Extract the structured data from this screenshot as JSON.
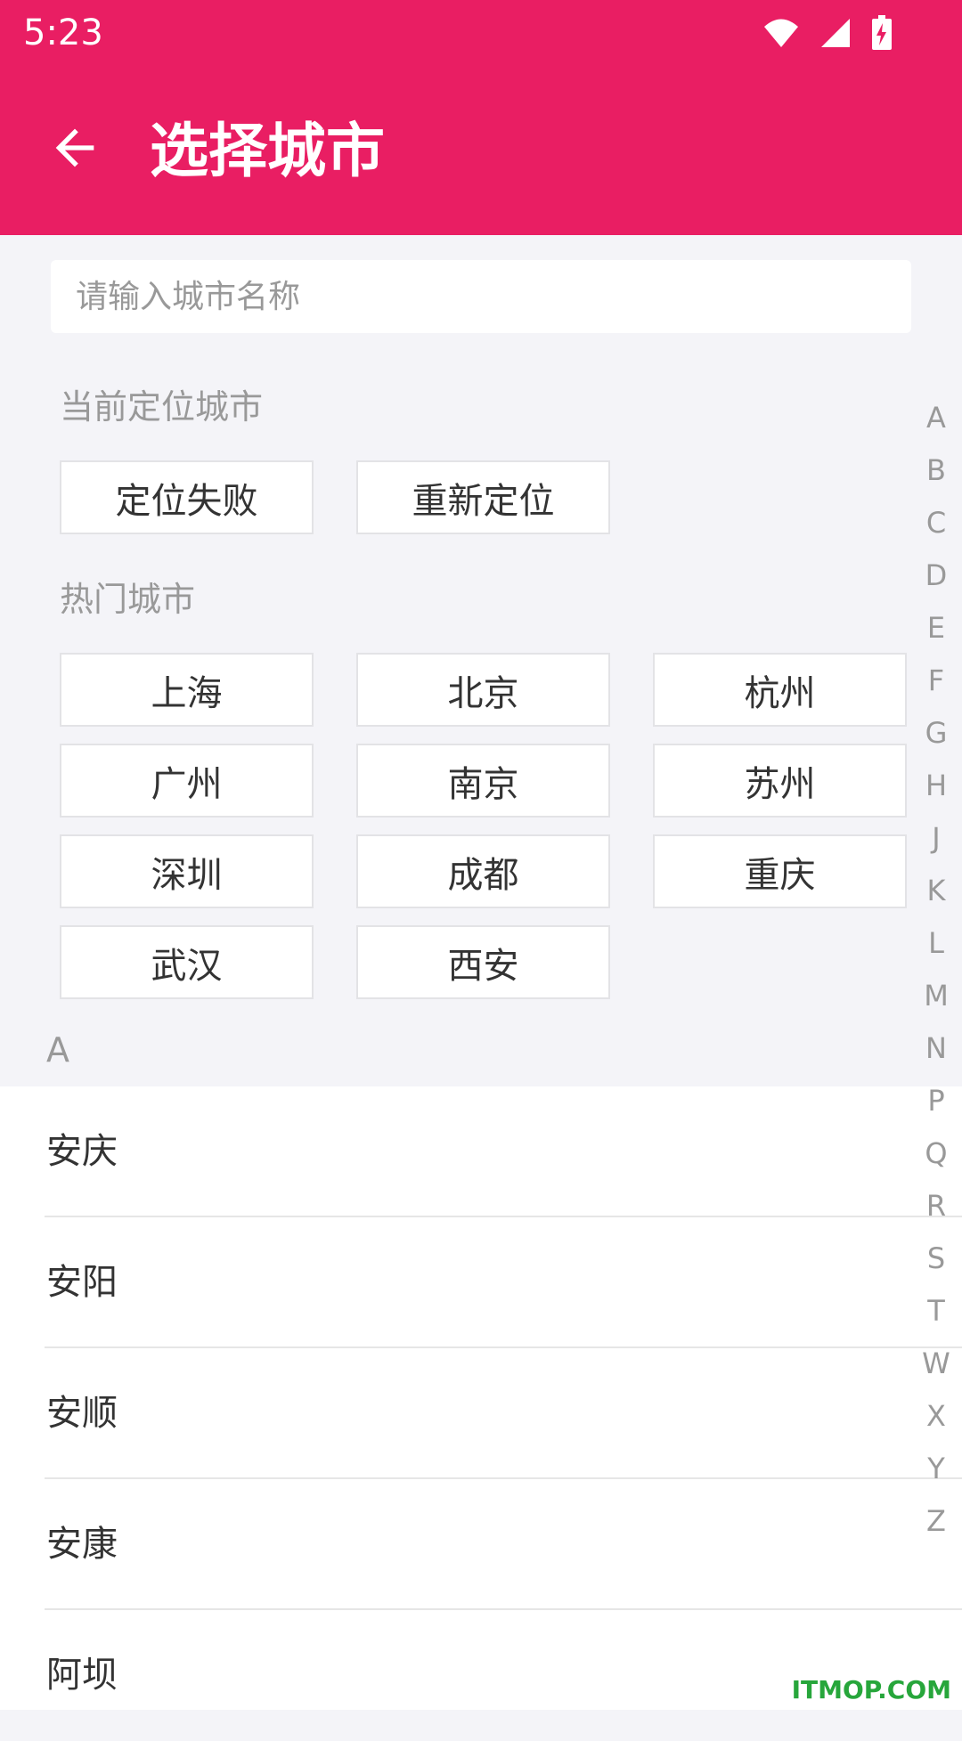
{
  "status_bar": {
    "time": "5:23",
    "icons": [
      "wifi-icon",
      "cell-signal-icon",
      "battery-charging-icon"
    ]
  },
  "header": {
    "back_icon": "arrow-left-icon",
    "title": "选择城市"
  },
  "search": {
    "placeholder": "请输入城市名称"
  },
  "location": {
    "label": "当前定位城市",
    "buttons": [
      "定位失败",
      "重新定位"
    ]
  },
  "hot": {
    "label": "热门城市",
    "cities": [
      "上海",
      "北京",
      "杭州",
      "广州",
      "南京",
      "苏州",
      "深圳",
      "成都",
      "重庆",
      "武汉",
      "西安"
    ]
  },
  "list": {
    "index_letter": "A",
    "cities": [
      "安庆",
      "安阳",
      "安顺",
      "安康",
      "阿坝"
    ]
  },
  "index_bar": [
    "A",
    "B",
    "C",
    "D",
    "E",
    "F",
    "G",
    "H",
    "J",
    "K",
    "L",
    "M",
    "N",
    "P",
    "Q",
    "R",
    "S",
    "T",
    "W",
    "X",
    "Y",
    "Z"
  ],
  "watermark": "ITMOP.COM",
  "colors": {
    "accent": "#e91e63",
    "background": "#f4f4f8"
  }
}
